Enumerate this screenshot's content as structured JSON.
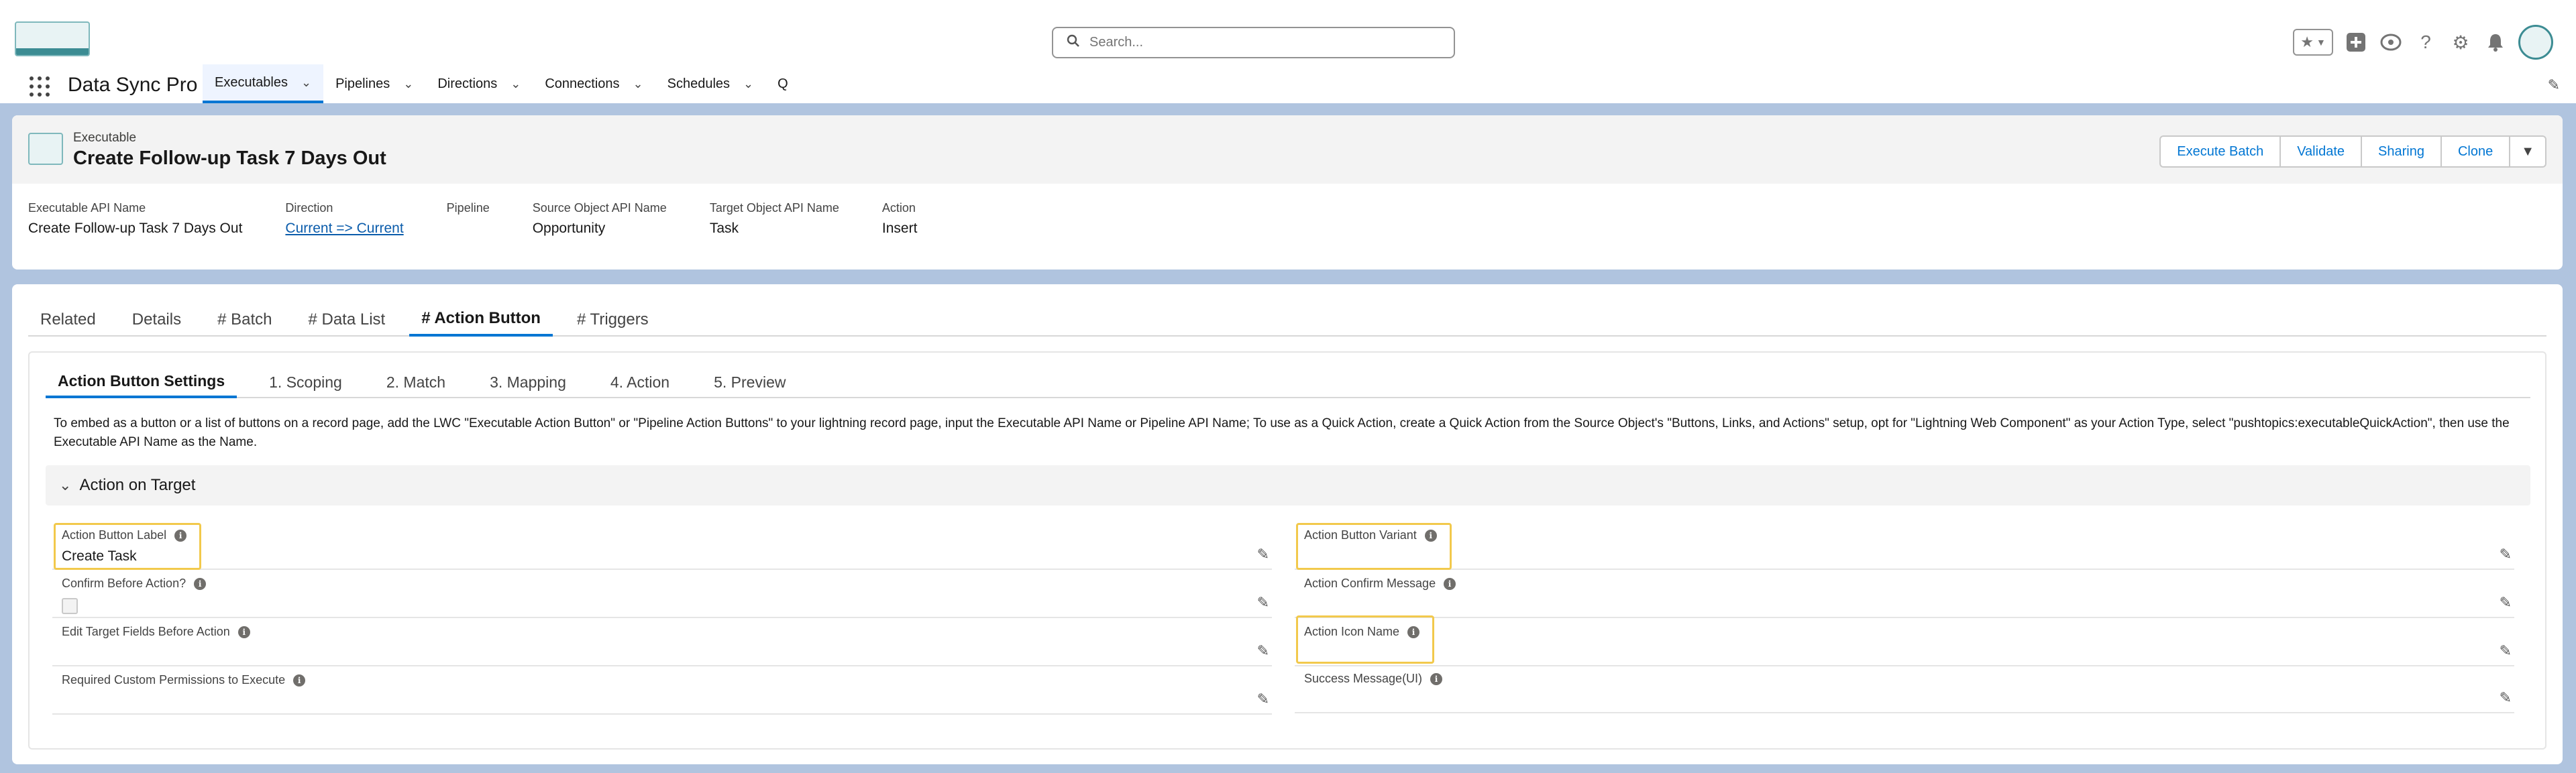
{
  "header": {
    "search_placeholder": "Search...",
    "icons": [
      "star-icon",
      "chevron-down-icon",
      "add-icon",
      "trailhead-icon",
      "help-icon",
      "gear-icon",
      "bell-icon"
    ]
  },
  "nav": {
    "app_name": "Data Sync Pro",
    "items": [
      {
        "label": "Executables",
        "active": true
      },
      {
        "label": "Pipelines"
      },
      {
        "label": "Directions"
      },
      {
        "label": "Connections"
      },
      {
        "label": "Schedules"
      },
      {
        "label": "Q"
      }
    ]
  },
  "record": {
    "type": "Executable",
    "title": "Create Follow-up Task 7 Days Out",
    "buttons": [
      "Execute Batch",
      "Validate",
      "Sharing",
      "Clone"
    ],
    "highlights": [
      {
        "label": "Executable API Name",
        "value": "Create Follow-up Task 7 Days Out"
      },
      {
        "label": "Direction",
        "value": "Current => Current"
      },
      {
        "label": "Pipeline",
        "value": ""
      },
      {
        "label": "Source Object API Name",
        "value": "Opportunity"
      },
      {
        "label": "Target Object API Name",
        "value": "Task"
      },
      {
        "label": "Action",
        "value": "Insert"
      }
    ]
  },
  "tabs": [
    "Related",
    "Details",
    "# Batch",
    "# Data List",
    "# Action Button",
    "# Triggers"
  ],
  "subtabs": [
    "Action Button Settings",
    "1. Scoping",
    "2. Match",
    "3. Mapping",
    "4. Action",
    "5. Preview"
  ],
  "description": "To embed as a button or a list of buttons on a record page, add the LWC \"Executable Action Button\" or \"Pipeline Action Buttons\" to your lightning record page, input the Executable API Name or Pipeline API Name; To use as a Quick Action, create a Quick Action from the Source Object's \"Buttons, Links, and Actions\" setup, opt for \"Lightning Web Component\" as your Action Type, select \"pushtopics:executableQuickAction\", then use the Executable API Name as the Name.",
  "section": {
    "title": "Action on Target",
    "left_fields": [
      {
        "label": "Action Button Label",
        "value": "Create Task"
      },
      {
        "label": "Confirm Before Action?",
        "value": ""
      },
      {
        "label": "Edit Target Fields Before Action",
        "value": ""
      },
      {
        "label": "Required Custom Permissions to Execute",
        "value": ""
      }
    ],
    "right_fields": [
      {
        "label": "Action Button Variant",
        "value": ""
      },
      {
        "label": "Action Confirm Message",
        "value": ""
      },
      {
        "label": "Action Icon Name",
        "value": ""
      },
      {
        "label": "Success Message(UI)",
        "value": ""
      }
    ]
  },
  "colors": {
    "brand": "#0176d3",
    "highlight": "#f2c94c",
    "background": "#b0c4df"
  }
}
